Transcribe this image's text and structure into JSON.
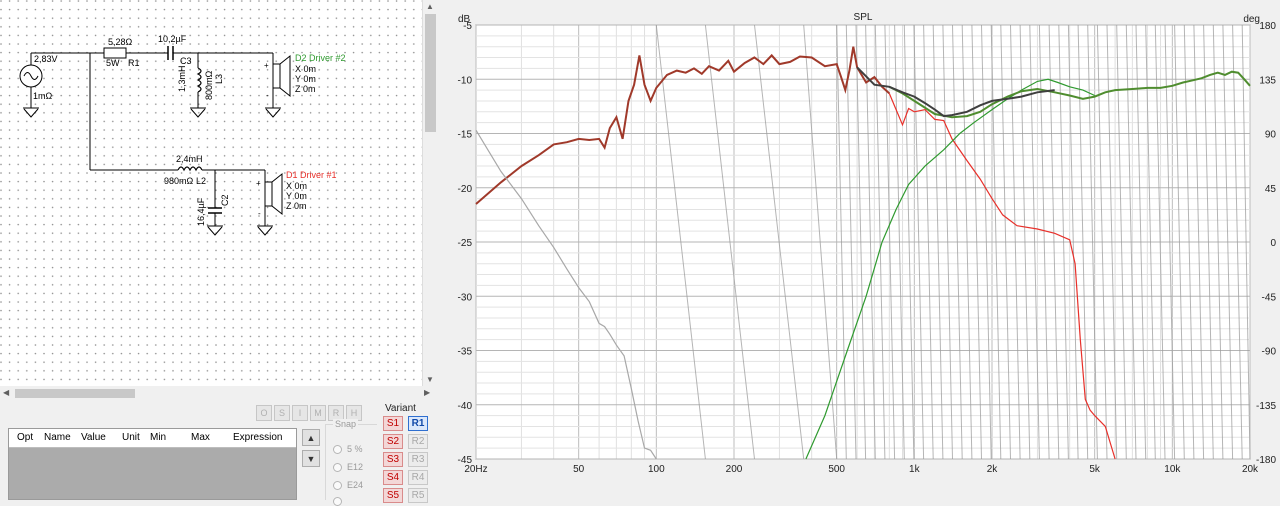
{
  "schematic": {
    "source": {
      "voltage": "2,83V",
      "resistance": "1mΩ"
    },
    "r1": {
      "value": "5,28Ω",
      "power": "5W",
      "name": "R1"
    },
    "c3": {
      "value": "10,2µF",
      "name": "C3"
    },
    "l3": {
      "value": "1,3mH",
      "resistance": "800mΩ",
      "name": "L3"
    },
    "l2": {
      "value": "2,4mH",
      "resistance": "980mΩ",
      "name": "L2"
    },
    "c2": {
      "value": "16,4µF",
      "name": "C2"
    },
    "driver2": {
      "name": "D2 Driver #2",
      "x": "X 0m",
      "y": "Y 0m",
      "z": "Z 0m"
    },
    "driver1": {
      "name": "D1 Driver #1",
      "x": "X 0m",
      "y": "Y 0m",
      "z": "Z 0m"
    },
    "pin_plus": "+",
    "pin_minus": "-"
  },
  "toolbar": {
    "buttons": [
      "O",
      "S",
      "I",
      "M",
      "R",
      "H"
    ]
  },
  "param_table": {
    "columns": [
      "Opt",
      "Name",
      "Value",
      "Unit",
      "Min",
      "Max",
      "Expression"
    ]
  },
  "nav": {
    "up": "▲",
    "down": "▼"
  },
  "snap": {
    "title": "Snap",
    "options": [
      "5 %",
      "E12",
      "E24"
    ]
  },
  "variant": {
    "title": "Variant",
    "s_buttons": [
      "S1",
      "S2",
      "S3",
      "S4",
      "S5"
    ],
    "r_buttons": [
      "R1",
      "R2",
      "R3",
      "R4",
      "R5"
    ],
    "active": "R1"
  },
  "chart_data": {
    "type": "line",
    "title": "SPL",
    "ylabel": "dB",
    "y2label": "deg",
    "xscale": "log",
    "xlim": [
      20,
      20000
    ],
    "ylim": [
      -45,
      -5
    ],
    "y2lim": [
      -180,
      180
    ],
    "grid": true,
    "xticks": [
      {
        "v": 20,
        "l": "20Hz"
      },
      {
        "v": 50,
        "l": "50"
      },
      {
        "v": 100,
        "l": "100"
      },
      {
        "v": 200,
        "l": "200"
      },
      {
        "v": 500,
        "l": "500"
      },
      {
        "v": 1000,
        "l": "1k"
      },
      {
        "v": 2000,
        "l": "2k"
      },
      {
        "v": 5000,
        "l": "5k"
      },
      {
        "v": 10000,
        "l": "10k"
      },
      {
        "v": 20000,
        "l": "20k"
      }
    ],
    "yticks": [
      -5,
      -10,
      -15,
      -20,
      -25,
      -30,
      -35,
      -40,
      -45
    ],
    "y2ticks": [
      180,
      135,
      90,
      45,
      0,
      -45,
      -90,
      -135,
      -180
    ],
    "colors": {
      "sum": "#a0392a",
      "sum_phase": "#a8a8a8",
      "driver1": "#e8302a",
      "driver2": "#2f9a2f",
      "driver2_phase": "#909090",
      "sum_hf": "#3f3f3f",
      "grid": "#cfcfcf",
      "hf_main": "#4f8d2f"
    },
    "series": [
      {
        "color": "#a0392a",
        "x": [
          20,
          25,
          30,
          35,
          40,
          45,
          50,
          55,
          60,
          63,
          66,
          70,
          74,
          78,
          82,
          86,
          90,
          95,
          100,
          110,
          120,
          130,
          140,
          150,
          160,
          175,
          190,
          200,
          220,
          240,
          260,
          280,
          300,
          330,
          360,
          400,
          450,
          500,
          520,
          540,
          560,
          580,
          600,
          650,
          700,
          750,
          800
        ],
        "y": [
          -21.5,
          -19.5,
          -18,
          -17,
          -16,
          -15.8,
          -15.5,
          -15.6,
          -15.5,
          -16.3,
          -14.5,
          -13.5,
          -15.5,
          -12,
          -10.5,
          -7.8,
          -10.5,
          -12,
          -10.8,
          -9.6,
          -9.2,
          -9.4,
          -9.0,
          -9.5,
          -8.8,
          -9.2,
          -8.3,
          -9.3,
          -8.5,
          -8.0,
          -8.6,
          -7.8,
          -8.6,
          -8.4,
          -7.9,
          -8.0,
          -8.8,
          -8.6,
          -9.8,
          -11,
          -9.2,
          -7.0,
          -8.9,
          -10.3,
          -9.8,
          -10.7,
          -11.3
        ]
      },
      {
        "color": "#e8302a",
        "x": [
          800,
          850,
          900,
          950,
          1000,
          1100,
          1200,
          1300,
          1400,
          1600,
          1800,
          2000,
          2200,
          2500,
          3000,
          3500,
          4000,
          4200,
          4400,
          4600,
          4800,
          5000,
          5500,
          6000
        ],
        "y": [
          -11.3,
          -12.8,
          -14.2,
          -12.7,
          -13.0,
          -12.8,
          -13.7,
          -13.8,
          -15.5,
          -17.5,
          -19.2,
          -21,
          -22.5,
          -23.5,
          -23.8,
          -24.2,
          -24.8,
          -27,
          -34,
          -39.5,
          -40.5,
          -41,
          -42,
          -45
        ]
      },
      {
        "color": "#2f9a2f",
        "x": [
          380,
          450,
          550,
          650,
          750,
          850,
          950,
          1100,
          1300,
          1500,
          1700,
          2000,
          2300,
          2600,
          3000,
          3300,
          3600,
          4000,
          4500,
          5000
        ],
        "y": [
          -45,
          -41,
          -35,
          -30,
          -25,
          -22,
          -19.7,
          -18,
          -16.5,
          -15,
          -14,
          -12.8,
          -11.8,
          -11.0,
          -10.2,
          -10.0,
          -10.3,
          -10.7,
          -11.0,
          -11.5
        ]
      },
      {
        "color": "#4f8d2f",
        "x": [
          800,
          900,
          1000,
          1200,
          1400,
          1600,
          1800,
          2000,
          2300,
          2600,
          3000,
          3500,
          4000,
          4500,
          5000,
          5500,
          6000,
          7000,
          8000,
          9000,
          10000,
          11000,
          12000,
          13000,
          14000,
          15000,
          16000,
          17000,
          18000,
          19000,
          20000
        ],
        "y": [
          -10.7,
          -11.3,
          -12.0,
          -13.2,
          -13.5,
          -13.4,
          -13.0,
          -12.3,
          -11.6,
          -11.1,
          -10.9,
          -11.2,
          -11.5,
          -11.8,
          -11.6,
          -11.2,
          -11.0,
          -10.9,
          -10.8,
          -10.8,
          -10.6,
          -10.3,
          -10.1,
          -9.9,
          -9.6,
          -9.4,
          -9.6,
          -9.3,
          -9.4,
          -10.0,
          -10.6
        ]
      },
      {
        "color": "#3f3f3f",
        "x": [
          600,
          700,
          800,
          900,
          1000,
          1100,
          1200,
          1300,
          1400,
          1600,
          1800,
          2000,
          2300,
          2600,
          3000,
          3500
        ],
        "y": [
          -8.9,
          -10.5,
          -10.7,
          -11.2,
          -11.6,
          -12.2,
          -12.8,
          -13.4,
          -13.3,
          -13.0,
          -12.4,
          -12.0,
          -11.8,
          -11.6,
          -11.2,
          -11.0
        ]
      },
      {
        "color": "#a8a8a8",
        "x": [
          20,
          25,
          30,
          35,
          40,
          45,
          50,
          55,
          60,
          63,
          66,
          70,
          75,
          80,
          85,
          90,
          95,
          100
        ],
        "y": [
          -14.7,
          -18.5,
          -21,
          -23.5,
          -25.5,
          -27.5,
          -29.2,
          -30.5,
          -32.5,
          -32.8,
          -33.5,
          -34.5,
          -35.5,
          -38.5,
          -41.5,
          -44,
          -44.2,
          -45
        ]
      }
    ]
  }
}
